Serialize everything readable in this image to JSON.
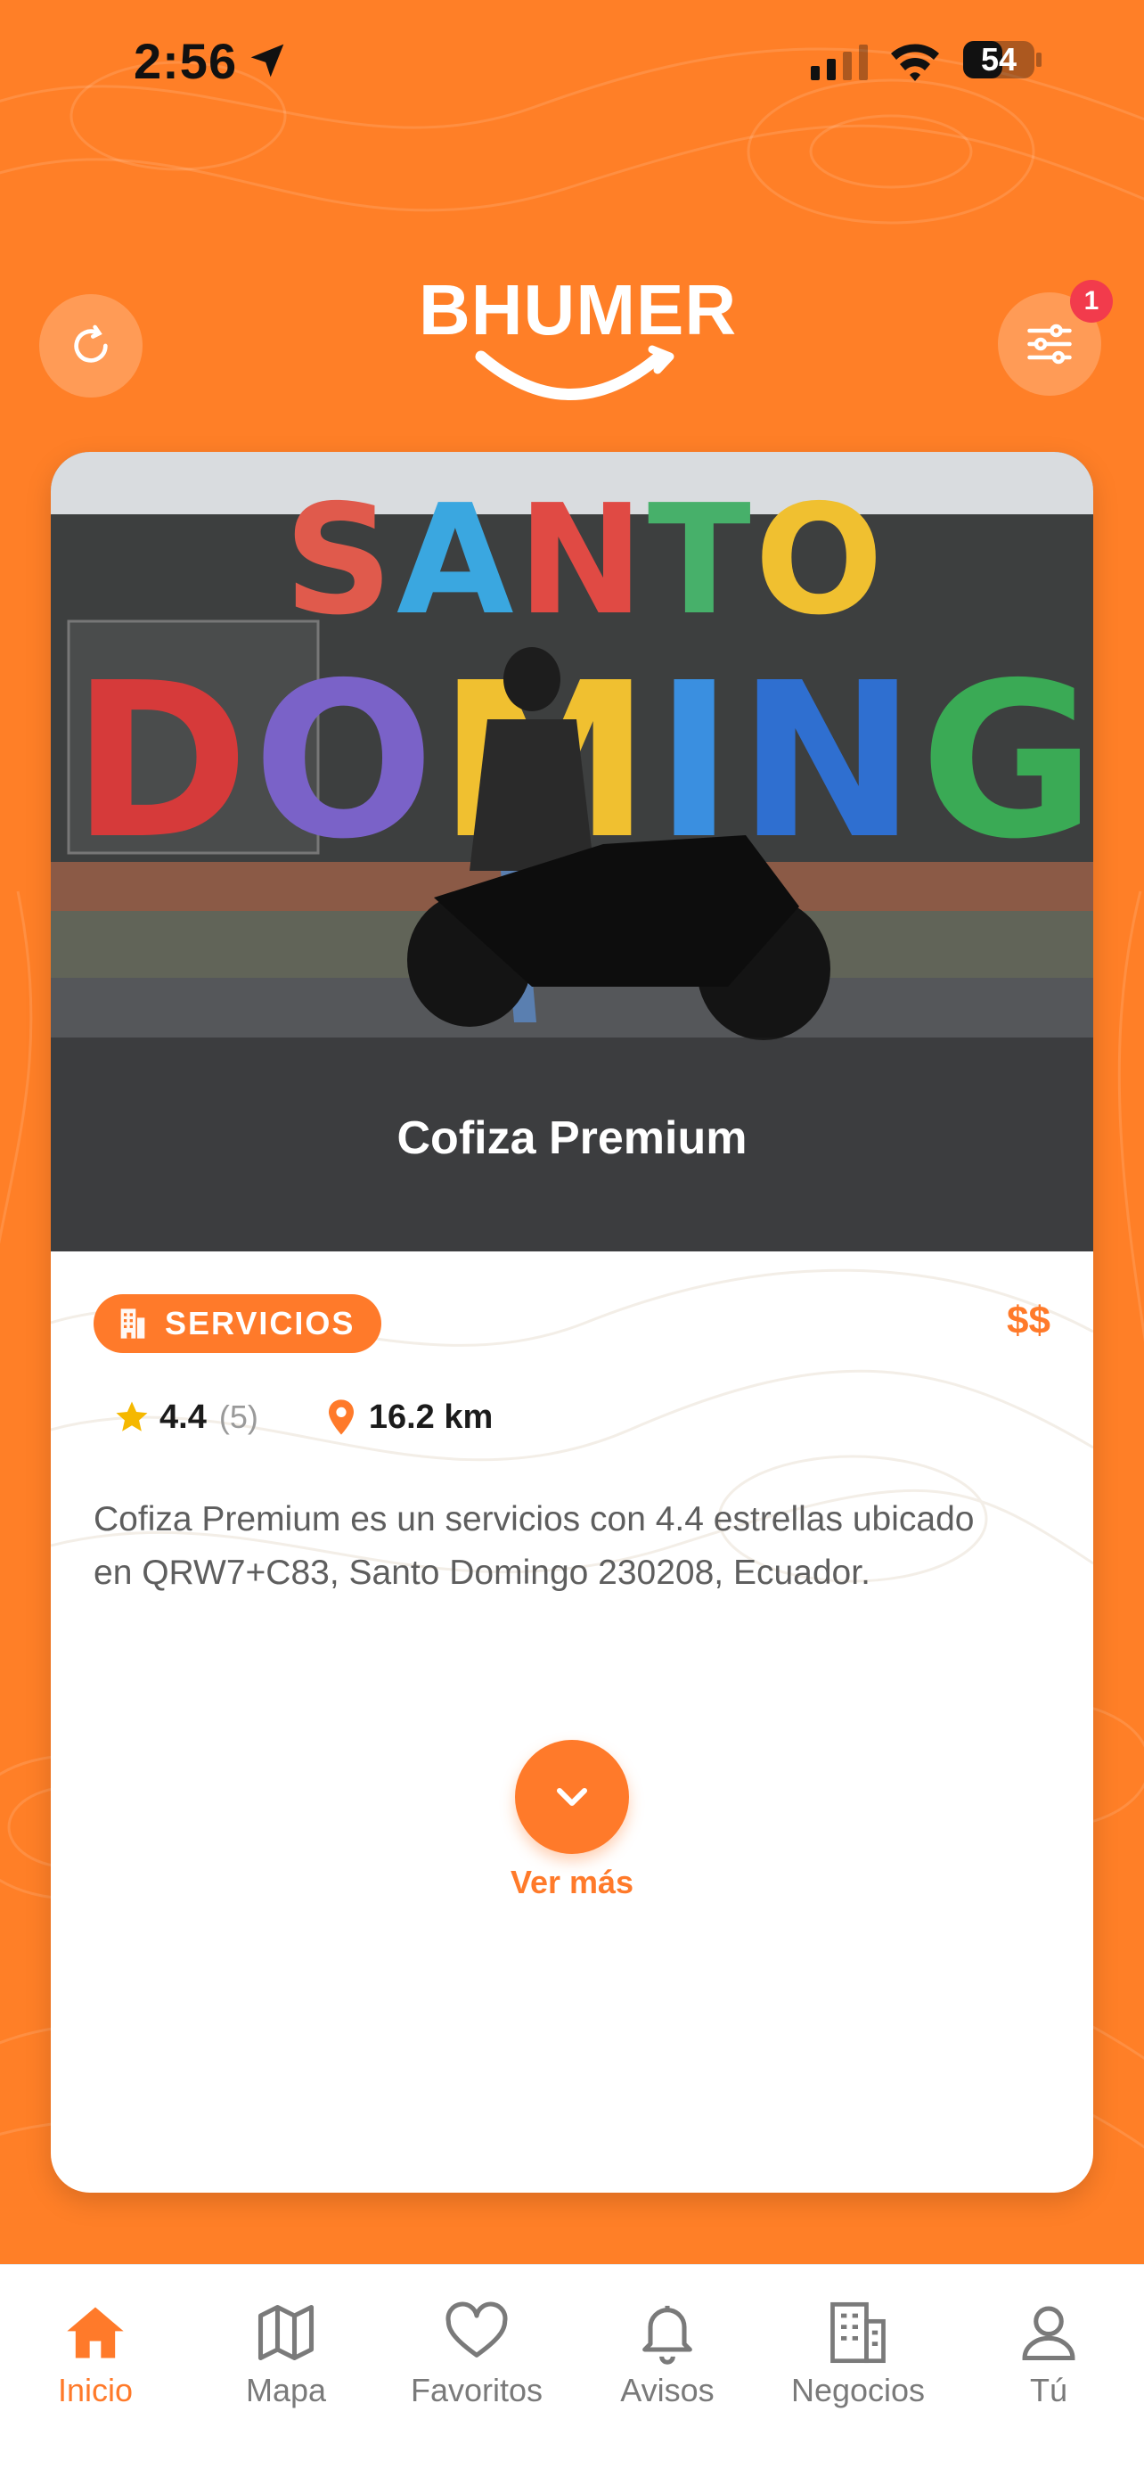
{
  "status_bar": {
    "time": "2:56",
    "battery": "54"
  },
  "header": {
    "logo_text": "BHUMER",
    "notification_count": "1"
  },
  "card": {
    "title": "Cofiza Premium",
    "category": "SERVICIOS",
    "price": "$$",
    "rating": "4.4",
    "rating_count": "(5)",
    "distance": "16.2 km",
    "description": "Cofiza Premium es un servicios con 4.4 estrellas ubicado en QRW7+C83, Santo Domingo 230208, Ecuador.",
    "more_label": "Ver más",
    "photo_sign_top": "SANTO",
    "photo_sign_bottom": "DOMINGO"
  },
  "tabs": [
    {
      "label": "Inicio",
      "icon": "home-icon",
      "active": true
    },
    {
      "label": "Mapa",
      "icon": "map-icon",
      "active": false
    },
    {
      "label": "Favoritos",
      "icon": "heart-icon",
      "active": false
    },
    {
      "label": "Avisos",
      "icon": "bell-icon",
      "active": false
    },
    {
      "label": "Negocios",
      "icon": "building-icon",
      "active": false
    },
    {
      "label": "Tú",
      "icon": "user-icon",
      "active": false
    }
  ],
  "colors": {
    "brand": "#FF7F27",
    "accent": "#FF7A2A",
    "badge": "#F23B4C",
    "star": "#F5B800"
  }
}
